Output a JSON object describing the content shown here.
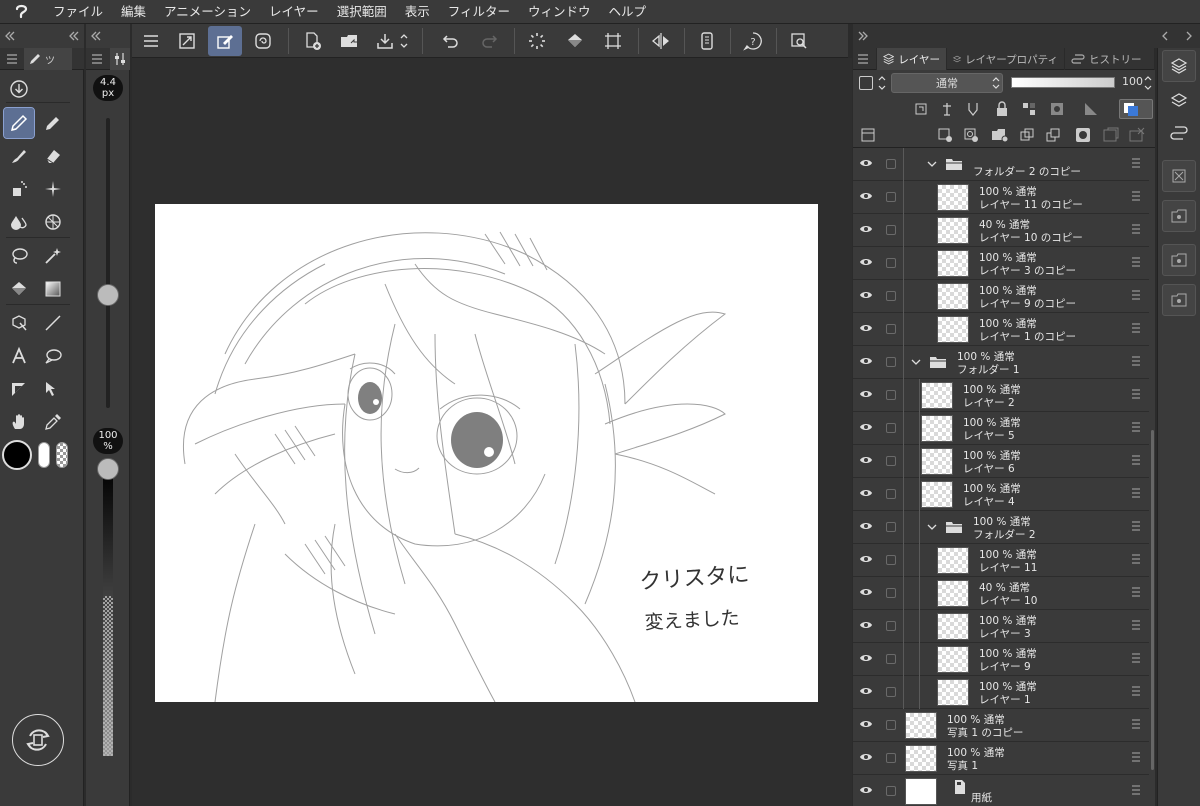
{
  "menu": {
    "items": [
      "ファイル",
      "編集",
      "アニメーション",
      "レイヤー",
      "選択範囲",
      "表示",
      "フィルター",
      "ウィンドウ",
      "ヘルプ"
    ]
  },
  "tool_panel": {
    "tab_label": "ツ"
  },
  "brush": {
    "size_value": "4.4",
    "size_unit": "px",
    "opacity_value": "100",
    "opacity_unit": "%"
  },
  "command_bar": {
    "icons": [
      "menu-icon",
      "fit-canvas-icon",
      "brush-tool-icon",
      "spiral-icon",
      "new-file-icon",
      "open-folder-icon",
      "save-icon",
      "undo-icon",
      "redo-icon",
      "loading-icon",
      "fill-icon",
      "crop-icon",
      "flip-icon",
      "smartphone-icon",
      "help-icon",
      "settings-search-icon"
    ]
  },
  "canvas": {
    "handwritten_line1": "クリスタに",
    "handwritten_line2": "変えました"
  },
  "layer_panel": {
    "tabs": [
      "レイヤー",
      "レイヤープロパティ",
      "ヒストリー"
    ],
    "blend_mode": "通常",
    "opacity": "100",
    "colors": {
      "accent": "#5d6f93",
      "panel": "#3a3a3a",
      "text": "#e6e6e6"
    },
    "partial_label": "100 % 通常",
    "layers": [
      {
        "l1": "",
        "l2": "フォルダー 2 のコピー",
        "type": "folder",
        "depth": 1
      },
      {
        "l1": "100 % 通常",
        "l2": "レイヤー 11 のコピー",
        "type": "layer",
        "depth": 2
      },
      {
        "l1": "40 % 通常",
        "l2": "レイヤー 10 のコピー",
        "type": "layer",
        "depth": 2
      },
      {
        "l1": "100 % 通常",
        "l2": "レイヤー 3 のコピー",
        "type": "layer",
        "depth": 2
      },
      {
        "l1": "100 % 通常",
        "l2": "レイヤー 9 のコピー",
        "type": "layer",
        "depth": 2
      },
      {
        "l1": "100 % 通常",
        "l2": "レイヤー 1 のコピー",
        "type": "layer",
        "depth": 2
      },
      {
        "l1": "100 % 通常",
        "l2": "フォルダー 1",
        "type": "folder",
        "depth": 0
      },
      {
        "l1": "100 % 通常",
        "l2": "レイヤー 2",
        "type": "layer",
        "depth": 1
      },
      {
        "l1": "100 % 通常",
        "l2": "レイヤー 5",
        "type": "layer",
        "depth": 1
      },
      {
        "l1": "100 % 通常",
        "l2": "レイヤー 6",
        "type": "layer",
        "depth": 1
      },
      {
        "l1": "100 % 通常",
        "l2": "レイヤー 4",
        "type": "layer",
        "depth": 1
      },
      {
        "l1": "100 % 通常",
        "l2": "フォルダー 2",
        "type": "folder",
        "depth": 1
      },
      {
        "l1": "100 % 通常",
        "l2": "レイヤー 11",
        "type": "layer",
        "depth": 2
      },
      {
        "l1": "40 % 通常",
        "l2": "レイヤー 10",
        "type": "layer",
        "depth": 2
      },
      {
        "l1": "100 % 通常",
        "l2": "レイヤー 3",
        "type": "layer",
        "depth": 2
      },
      {
        "l1": "100 % 通常",
        "l2": "レイヤー 9",
        "type": "layer",
        "depth": 2
      },
      {
        "l1": "100 % 通常",
        "l2": "レイヤー 1",
        "type": "layer",
        "depth": 2
      },
      {
        "l1": "100 % 通常",
        "l2": "写真 1 のコピー",
        "type": "layer",
        "depth": 0
      },
      {
        "l1": "100 % 通常",
        "l2": "写真 1",
        "type": "layer",
        "depth": 0
      },
      {
        "l1": "",
        "l2": "用紙",
        "type": "paper",
        "depth": 0
      }
    ]
  }
}
